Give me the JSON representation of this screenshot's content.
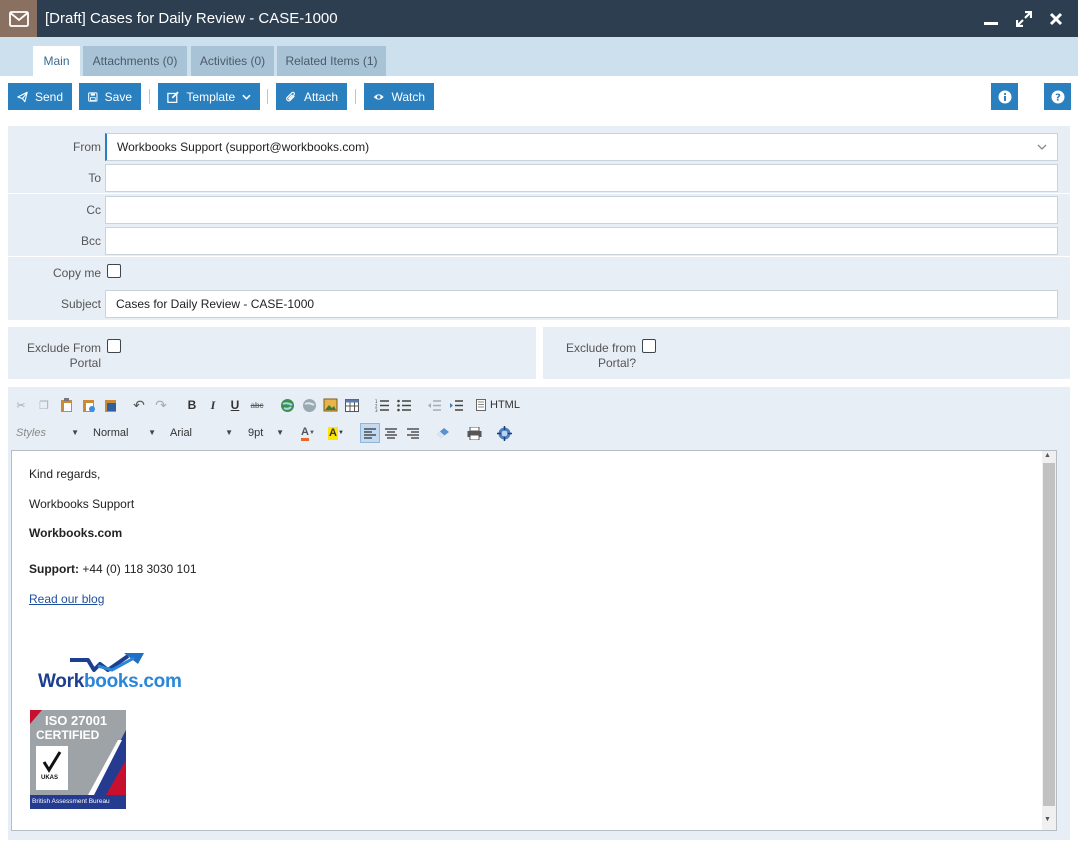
{
  "window": {
    "title": "[Draft] Cases for Daily Review - CASE-1000"
  },
  "tabs": [
    {
      "label": "Main",
      "active": true
    },
    {
      "label": "Attachments (0)"
    },
    {
      "label": "Activities (0)"
    },
    {
      "label": "Related Items (1)"
    }
  ],
  "toolbar": {
    "send": "Send",
    "save": "Save",
    "template": "Template",
    "attach": "Attach",
    "watch": "Watch"
  },
  "form": {
    "from_label": "From",
    "from_value": "Workbooks Support (support@workbooks.com)",
    "to_label": "To",
    "to_value": "",
    "cc_label": "Cc",
    "cc_value": "",
    "bcc_label": "Bcc",
    "bcc_value": "",
    "copy_me_label": "Copy me",
    "subject_label": "Subject",
    "subject_value": "Cases for Daily Review - CASE-1000",
    "exclude_from_portal_label_1": "Exclude From",
    "exclude_from_portal_label_2": "Portal",
    "exclude_from_portal2_label_1": "Exclude from",
    "exclude_from_portal2_label_2": "Portal?"
  },
  "editor": {
    "html_label": "HTML",
    "styles": "Styles",
    "format": "Normal",
    "font": "Arial",
    "size": "9pt"
  },
  "content": {
    "line1": "Kind regards,",
    "line2": "Workbooks Support",
    "line3": "Workbooks.com",
    "support_label": "Support:",
    "support_phone": "+44 (0) 118 3030 101",
    "blog_link": "Read our blog",
    "logo_text_1": "Work",
    "logo_text_2": "books.com",
    "iso_line1": "ISO 27001",
    "iso_line2": "CERTIFIED",
    "iso_footer": "British Assessment Bureau",
    "ukas": "UKAS"
  },
  "colors": {
    "titlebar": "#2c3e50",
    "accent": "#2a7fbf",
    "panel": "#e8eef5"
  }
}
